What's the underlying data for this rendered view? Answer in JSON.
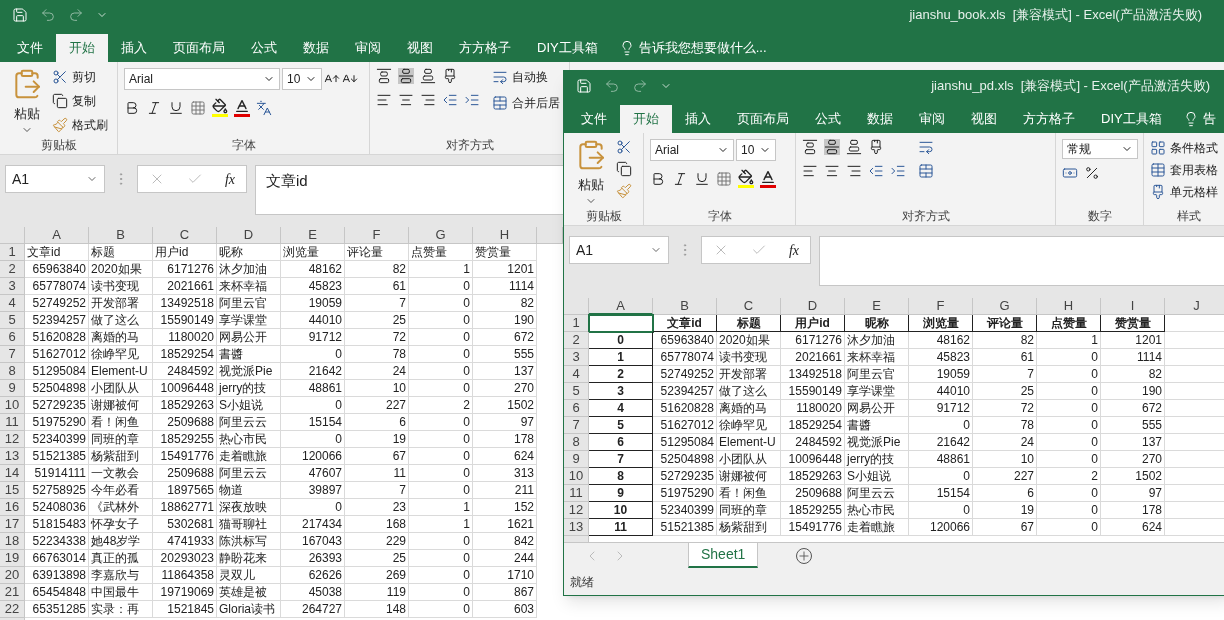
{
  "windows": [
    {
      "title": "jianshu_book.xls  [兼容模式] - Excel(产品激活失败)",
      "active": false,
      "tabs": [
        {
          "label": "文件",
          "selected": false
        },
        {
          "label": "开始",
          "selected": true
        },
        {
          "label": "插入",
          "selected": false
        },
        {
          "label": "页面布局",
          "selected": false
        },
        {
          "label": "公式",
          "selected": false
        },
        {
          "label": "数据",
          "selected": false
        },
        {
          "label": "审阅",
          "selected": false
        },
        {
          "label": "视图",
          "selected": false
        },
        {
          "label": "方方格子",
          "selected": false
        },
        {
          "label": "DIY工具箱",
          "selected": false
        }
      ],
      "tell_me": "告诉我您想要做什么...",
      "ribbon": {
        "clipboard": {
          "paste": "粘贴",
          "cut": "剪切",
          "copy": "复制",
          "format_painter": "格式刷",
          "label": "剪贴板"
        },
        "font": {
          "name": "Arial",
          "size": "10",
          "label": "字体"
        },
        "alignment": {
          "wrap_text": "自动换",
          "merge": "合并后居",
          "label": "对齐方式"
        }
      },
      "name_box": "A1",
      "function_symbol": "fx",
      "formula": "文章id",
      "sheet": {
        "kind": "plain",
        "columns": [
          "A",
          "B",
          "C",
          "D",
          "E",
          "F",
          "G",
          "H"
        ],
        "rows": [
          {
            "number": "1",
            "cells": [
              "文章id",
              "标题",
              "用户id",
              "昵称",
              "浏览量",
              "评论量",
              "点赞量",
              "赞赏量"
            ]
          },
          {
            "number": "2",
            "cells": [
              "65963840",
              "2020如果",
              "6171276",
              "沐夕加油",
              "48162",
              "82",
              "1",
              "1201"
            ]
          },
          {
            "number": "3",
            "cells": [
              "65778074",
              "读书变现",
              "2021661",
              "来杯幸福",
              "45823",
              "61",
              "0",
              "1114"
            ]
          },
          {
            "number": "4",
            "cells": [
              "52749252",
              "开发部署",
              "13492518",
              "阿里云官",
              "19059",
              "7",
              "0",
              "82"
            ]
          },
          {
            "number": "5",
            "cells": [
              "52394257",
              "做了这么",
              "15590149",
              "享学课堂",
              "44010",
              "25",
              "0",
              "190"
            ]
          },
          {
            "number": "6",
            "cells": [
              "51620828",
              "离婚的马",
              "1180020",
              "网易公开",
              "91712",
              "72",
              "0",
              "672"
            ]
          },
          {
            "number": "7",
            "cells": [
              "51627012",
              "徐峥罕见",
              "18529254",
              "書醬",
              "0",
              "78",
              "0",
              "555"
            ]
          },
          {
            "number": "8",
            "cells": [
              "51295084",
              "Element-U",
              "2484592",
              "视觉派Pie",
              "21642",
              "24",
              "0",
              "137"
            ]
          },
          {
            "number": "9",
            "cells": [
              "52504898",
              "小团队从",
              "10096448",
              "jerry的技",
              "48861",
              "10",
              "0",
              "270"
            ]
          },
          {
            "number": "10",
            "cells": [
              "52729235",
              "谢娜被何",
              "18529263",
              "S小姐说",
              "0",
              "227",
              "2",
              "1502"
            ]
          },
          {
            "number": "11",
            "cells": [
              "51975290",
              "看！闲鱼",
              "2509688",
              "阿里云云",
              "15154",
              "6",
              "0",
              "97"
            ]
          },
          {
            "number": "12",
            "cells": [
              "52340399",
              "同班的章",
              "18529255",
              "热心市民",
              "0",
              "19",
              "0",
              "178"
            ]
          },
          {
            "number": "13",
            "cells": [
              "51521385",
              "杨紫甜到",
              "15491776",
              "走着瞧旅",
              "120066",
              "67",
              "0",
              "624"
            ]
          },
          {
            "number": "14",
            "cells": [
              "51914111",
              "一文教会",
              "2509688",
              "阿里云云",
              "47607",
              "11",
              "0",
              "313"
            ]
          },
          {
            "number": "15",
            "cells": [
              "52758925",
              "今年必看",
              "1897565",
              "物道",
              "39897",
              "7",
              "0",
              "211"
            ]
          },
          {
            "number": "16",
            "cells": [
              "52408036",
              "《武林外",
              "18862771",
              "深夜放映",
              "0",
              "23",
              "1",
              "152"
            ]
          },
          {
            "number": "17",
            "cells": [
              "51815483",
              "怀孕女子",
              "5302681",
              "猫哥聊社",
              "217434",
              "168",
              "1",
              "1621"
            ]
          },
          {
            "number": "18",
            "cells": [
              "52234338",
              "她48岁学",
              "4741933",
              "陈洪标写",
              "167043",
              "229",
              "0",
              "842"
            ]
          },
          {
            "number": "19",
            "cells": [
              "66763014",
              "真正的孤",
              "20293023",
              "静盼花来",
              "26393",
              "25",
              "0",
              "244"
            ]
          },
          {
            "number": "20",
            "cells": [
              "63913898",
              "李嘉欣与",
              "11864358",
              "灵双儿",
              "62626",
              "269",
              "0",
              "1710"
            ]
          },
          {
            "number": "21",
            "cells": [
              "65454848",
              "中国最牛",
              "19719069",
              "英雄是被",
              "45038",
              "119",
              "0",
              "867"
            ]
          },
          {
            "number": "22",
            "cells": [
              "65351285",
              "实录：再",
              "1521845",
              "Gloria读书",
              "264727",
              "148",
              "0",
              "603"
            ]
          }
        ]
      }
    },
    {
      "title": "jianshu_pd.xls  [兼容模式] - Excel(产品激活失败)",
      "active": true,
      "tabs": [
        {
          "label": "文件",
          "selected": false
        },
        {
          "label": "开始",
          "selected": true
        },
        {
          "label": "插入",
          "selected": false
        },
        {
          "label": "页面布局",
          "selected": false
        },
        {
          "label": "公式",
          "selected": false
        },
        {
          "label": "数据",
          "selected": false
        },
        {
          "label": "审阅",
          "selected": false
        },
        {
          "label": "视图",
          "selected": false
        },
        {
          "label": "方方格子",
          "selected": false
        },
        {
          "label": "DIY工具箱",
          "selected": false
        }
      ],
      "tell_me": "告",
      "ribbon": {
        "clipboard": {
          "paste": "粘贴",
          "label": "剪贴板"
        },
        "font": {
          "name": "Arial",
          "size": "10",
          "label": "字体"
        },
        "alignment": {
          "label": "对齐方式"
        },
        "number": {
          "format": "常规",
          "label": "数字"
        },
        "styles": {
          "items": [
            "条件格式",
            "套用表格",
            "单元格样"
          ],
          "label": "样式"
        }
      },
      "name_box": "A1",
      "function_symbol": "fx",
      "sheet": {
        "kind": "indexed",
        "columns": [
          "A",
          "B",
          "C",
          "D",
          "E",
          "F",
          "G",
          "H",
          "I",
          "J"
        ],
        "rows": [
          {
            "number": "1",
            "cells": [
              "",
              "文章id",
              "标题",
              "用户id",
              "昵称",
              "浏览量",
              "评论量",
              "点赞量",
              "赞赏量"
            ]
          },
          {
            "number": "2",
            "cells": [
              "0",
              "65963840",
              "2020如果",
              "6171276",
              "沐夕加油",
              "48162",
              "82",
              "1",
              "1201"
            ]
          },
          {
            "number": "3",
            "cells": [
              "1",
              "65778074",
              "读书变现",
              "2021661",
              "来杯幸福",
              "45823",
              "61",
              "0",
              "1114"
            ]
          },
          {
            "number": "4",
            "cells": [
              "2",
              "52749252",
              "开发部署",
              "13492518",
              "阿里云官",
              "19059",
              "7",
              "0",
              "82"
            ]
          },
          {
            "number": "5",
            "cells": [
              "3",
              "52394257",
              "做了这么",
              "15590149",
              "享学课堂",
              "44010",
              "25",
              "0",
              "190"
            ]
          },
          {
            "number": "6",
            "cells": [
              "4",
              "51620828",
              "离婚的马",
              "1180020",
              "网易公开",
              "91712",
              "72",
              "0",
              "672"
            ]
          },
          {
            "number": "7",
            "cells": [
              "5",
              "51627012",
              "徐峥罕见",
              "18529254",
              "書醬",
              "0",
              "78",
              "0",
              "555"
            ]
          },
          {
            "number": "8",
            "cells": [
              "6",
              "51295084",
              "Element-U",
              "2484592",
              "视觉派Pie",
              "21642",
              "24",
              "0",
              "137"
            ]
          },
          {
            "number": "9",
            "cells": [
              "7",
              "52504898",
              "小团队从",
              "10096448",
              "jerry的技",
              "48861",
              "10",
              "0",
              "270"
            ]
          },
          {
            "number": "10",
            "cells": [
              "8",
              "52729235",
              "谢娜被何",
              "18529263",
              "S小姐说",
              "0",
              "227",
              "2",
              "1502"
            ]
          },
          {
            "number": "11",
            "cells": [
              "9",
              "51975290",
              "看！闲鱼",
              "2509688",
              "阿里云云",
              "15154",
              "6",
              "0",
              "97"
            ]
          },
          {
            "number": "12",
            "cells": [
              "10",
              "52340399",
              "同班的章",
              "18529255",
              "热心市民",
              "0",
              "19",
              "0",
              "178"
            ]
          },
          {
            "number": "13",
            "cells": [
              "11",
              "51521385",
              "杨紫甜到",
              "15491776",
              "走着瞧旅",
              "120066",
              "67",
              "0",
              "624"
            ]
          }
        ]
      },
      "sheet_tabs": [
        {
          "label": "Sheet1",
          "selected": true
        }
      ],
      "status": "就绪"
    }
  ]
}
